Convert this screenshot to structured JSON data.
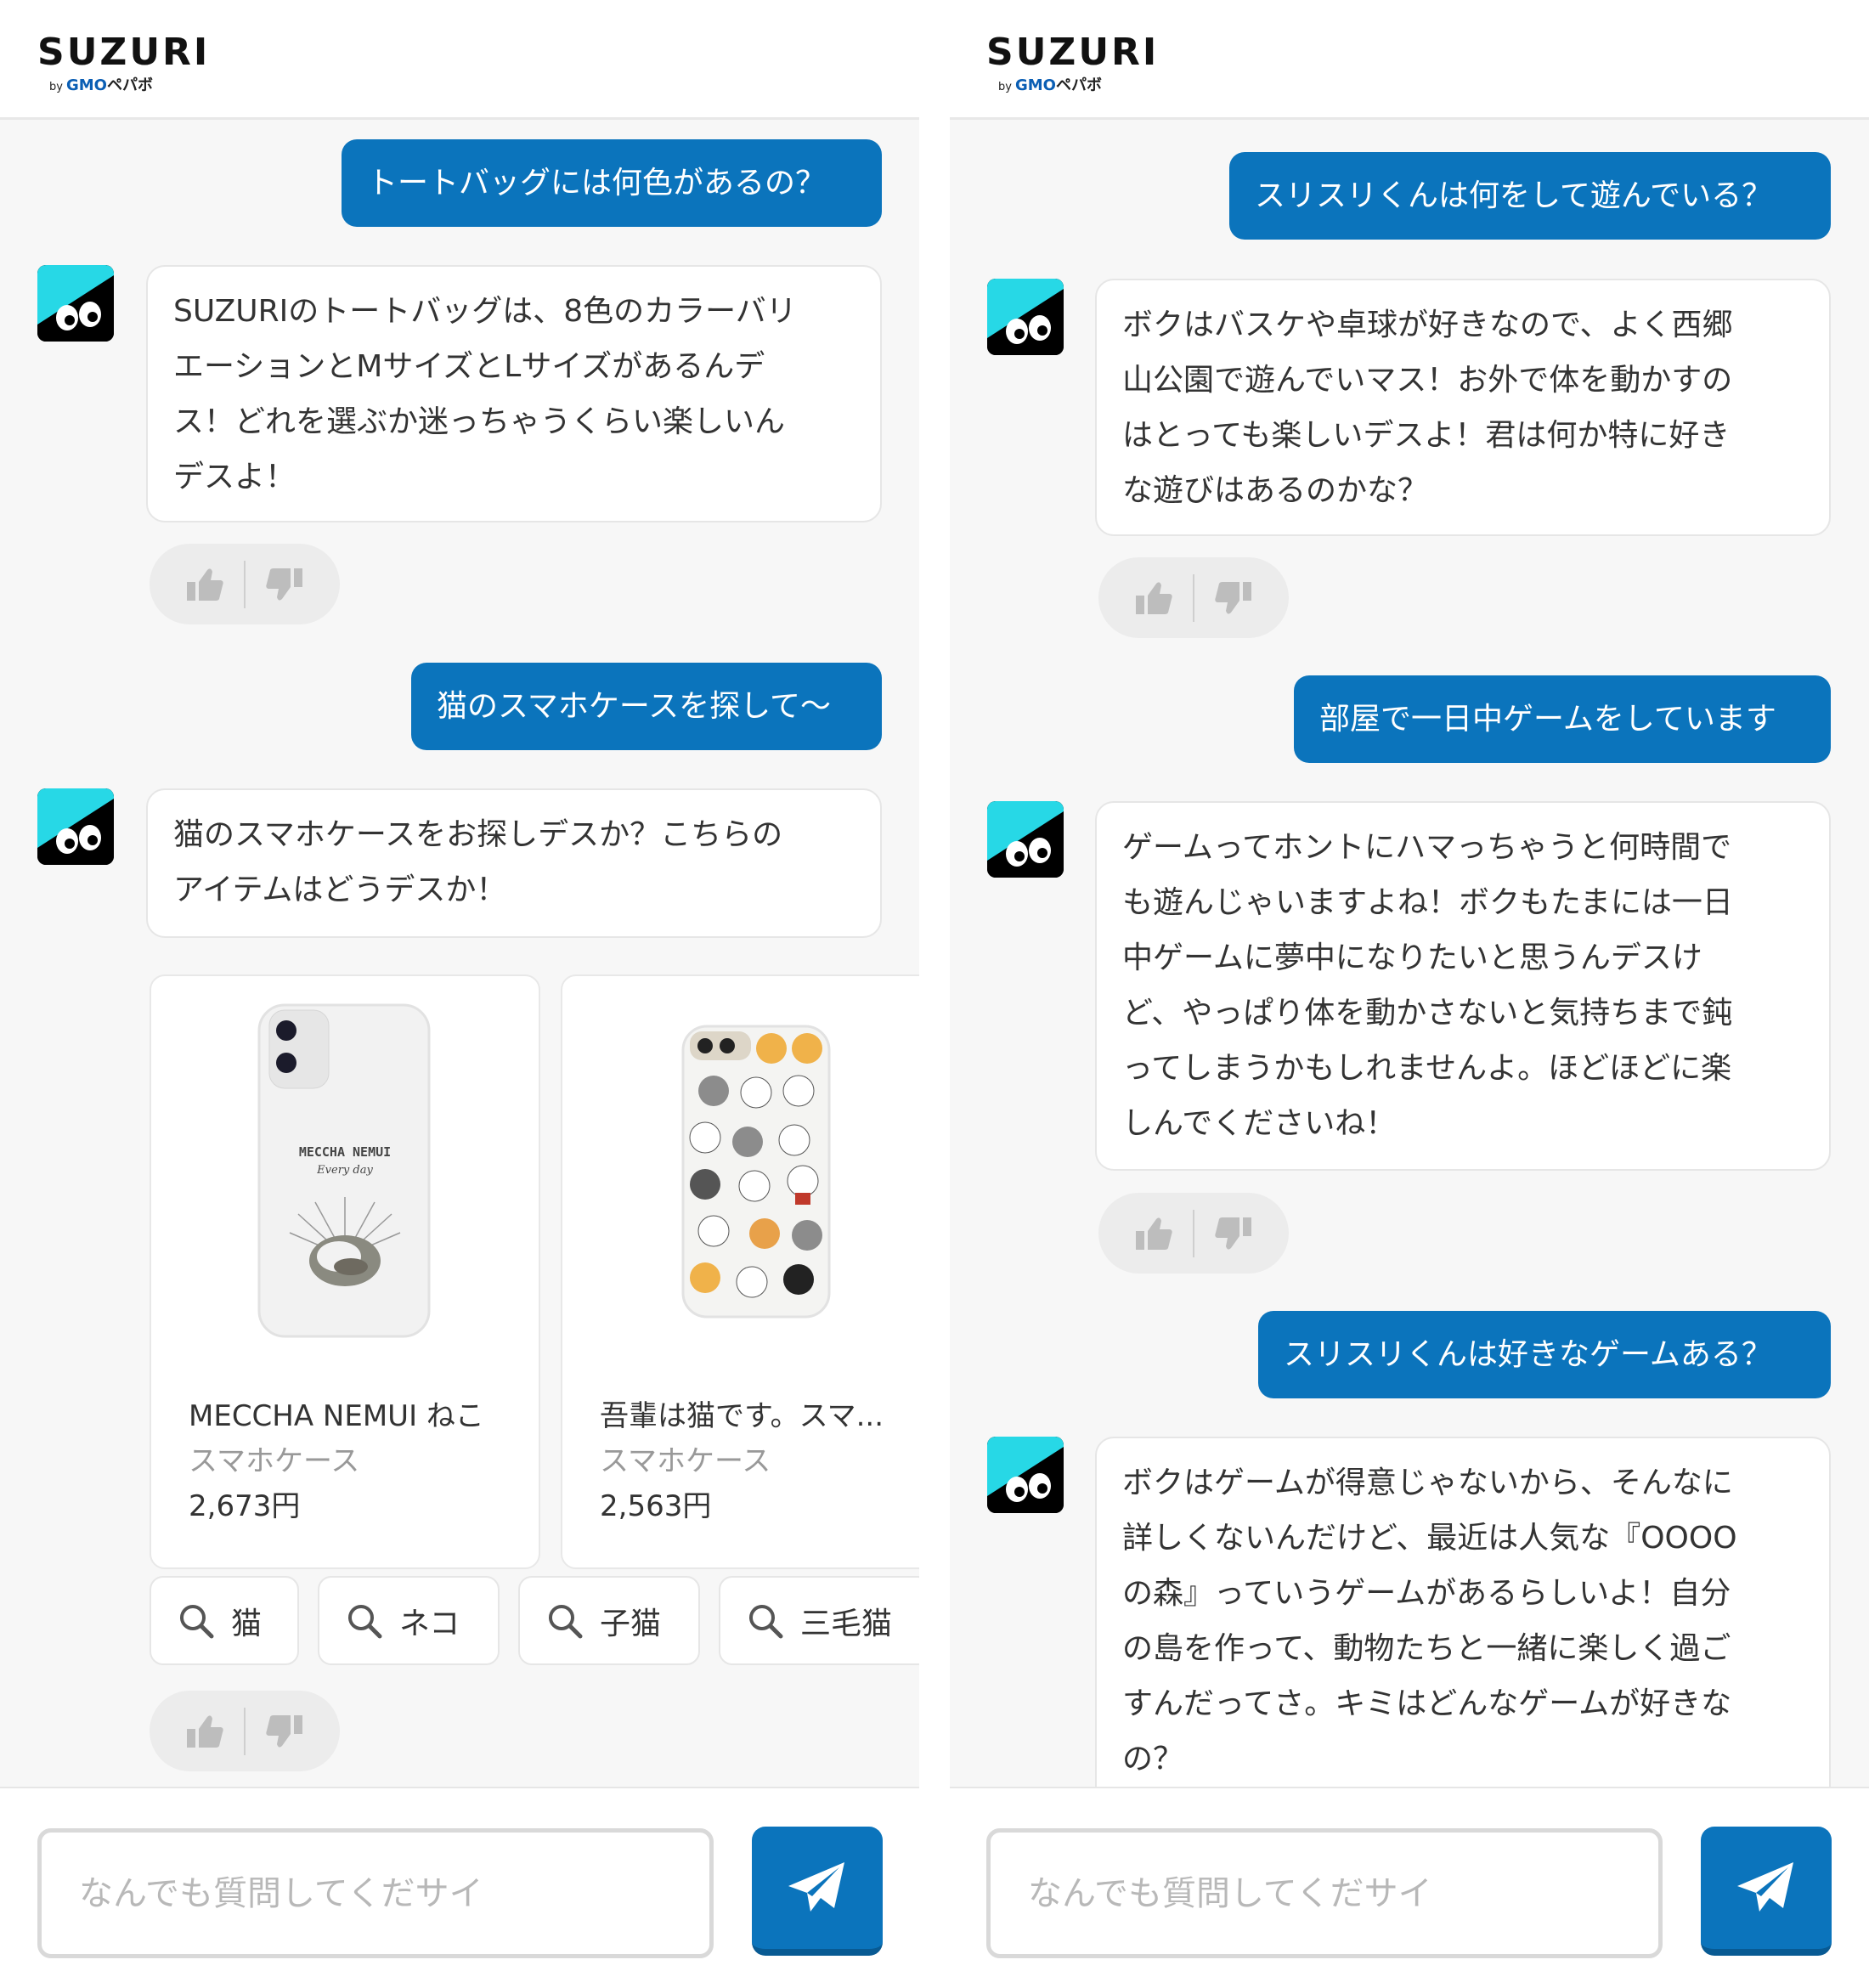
{
  "brand": {
    "logo_text": "SUZURI",
    "logo_by": "by",
    "logo_gmo": "GMO",
    "logo_pepabo": "ペパボ"
  },
  "left_panel": {
    "messages": [
      {
        "role": "user",
        "text": "トートバッグには何色があるの？"
      },
      {
        "role": "bot",
        "lines": [
          "SUZURIのトートバッグは、8色のカラーバリ",
          "エーションとMサイズとLサイズがあるんデ",
          "ス！どれを選ぶか迷っちゃうくらい楽しいん",
          "デスよ！"
        ]
      },
      {
        "role": "user",
        "text": "猫のスマホケースを探して〜"
      },
      {
        "role": "bot",
        "lines": [
          "猫のスマホケースをお探しデスか？こちらの",
          "アイテムはどうデスか！"
        ]
      }
    ],
    "products": [
      {
        "name": "MECCHA NEMUI ねこ",
        "type": "スマホケース",
        "price": "2,673円",
        "case_text1": "MECCHA NEMUI",
        "case_text2": "Every day"
      },
      {
        "name": "吾輩は猫です。スマ...",
        "type": "スマホケース",
        "price": "2,563円"
      }
    ],
    "search_chips": [
      "猫",
      "ネコ",
      "子猫",
      "三毛猫"
    ]
  },
  "right_panel": {
    "messages": [
      {
        "role": "user",
        "text": "スリスリくんは何をして遊んでいる？"
      },
      {
        "role": "bot",
        "lines": [
          "ボクはバスケや卓球が好きなので、よく西郷",
          "山公園で遊んでいマス！お外で体を動かすの",
          "はとっても楽しいデスよ！君は何か特に好き",
          "な遊びはあるのかな？"
        ]
      },
      {
        "role": "user",
        "text": "部屋で一日中ゲームをしています"
      },
      {
        "role": "bot",
        "lines": [
          "ゲームってホントにハマっちゃうと何時間で",
          "も遊んじゃいますよね！ボクもたまには一日",
          "中ゲームに夢中になりたいと思うんデスけ",
          "ど、やっぱり体を動かさないと気持ちまで鈍",
          "ってしまうかもしれませんよ。ほどほどに楽",
          "しんでくださいね！"
        ]
      },
      {
        "role": "user",
        "text": "スリスリくんは好きなゲームある？"
      },
      {
        "role": "bot",
        "lines": [
          "ボクはゲームが得意じゃないから、そんなに",
          "詳しくないんだけど、最近は人気な『OOOO",
          "の森』っていうゲームがあるらしいよ！自分",
          "の島を作って、動物たちと一緒に楽しく過ご",
          "すんだってさ。キミはどんなゲームが好きな",
          "の？"
        ]
      }
    ]
  },
  "input": {
    "placeholder": "なんでも質問してくだサイ"
  },
  "icons": {
    "like": "thumbs-up-icon",
    "dislike": "thumbs-down-icon",
    "send": "paper-plane-icon",
    "search": "search-icon",
    "avatar": "surisuri-mascot-icon"
  },
  "colors": {
    "accent": "#0b74bc",
    "panel_bg": "#f7f7f7",
    "bubble_bg": "#ffffff",
    "avatar_cyan": "#27d8e6"
  }
}
